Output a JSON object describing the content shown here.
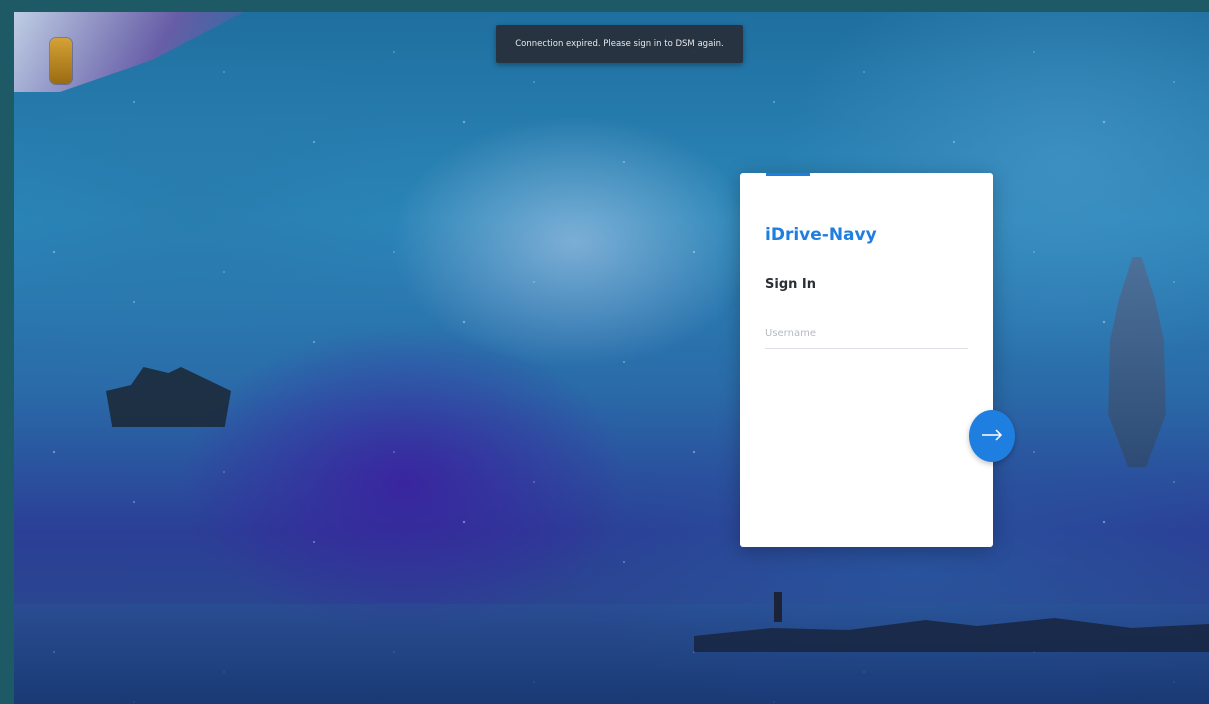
{
  "toast": {
    "message": "Connection expired. Please sign in to DSM again."
  },
  "login": {
    "brand": "iDrive-Navy",
    "heading": "Sign In",
    "username_placeholder": "Username",
    "username_value": "",
    "next_icon": "arrow-right-icon"
  },
  "colors": {
    "accent": "#1e7fe0",
    "toast_bg": "#282e38",
    "card_bg": "#ffffff"
  }
}
